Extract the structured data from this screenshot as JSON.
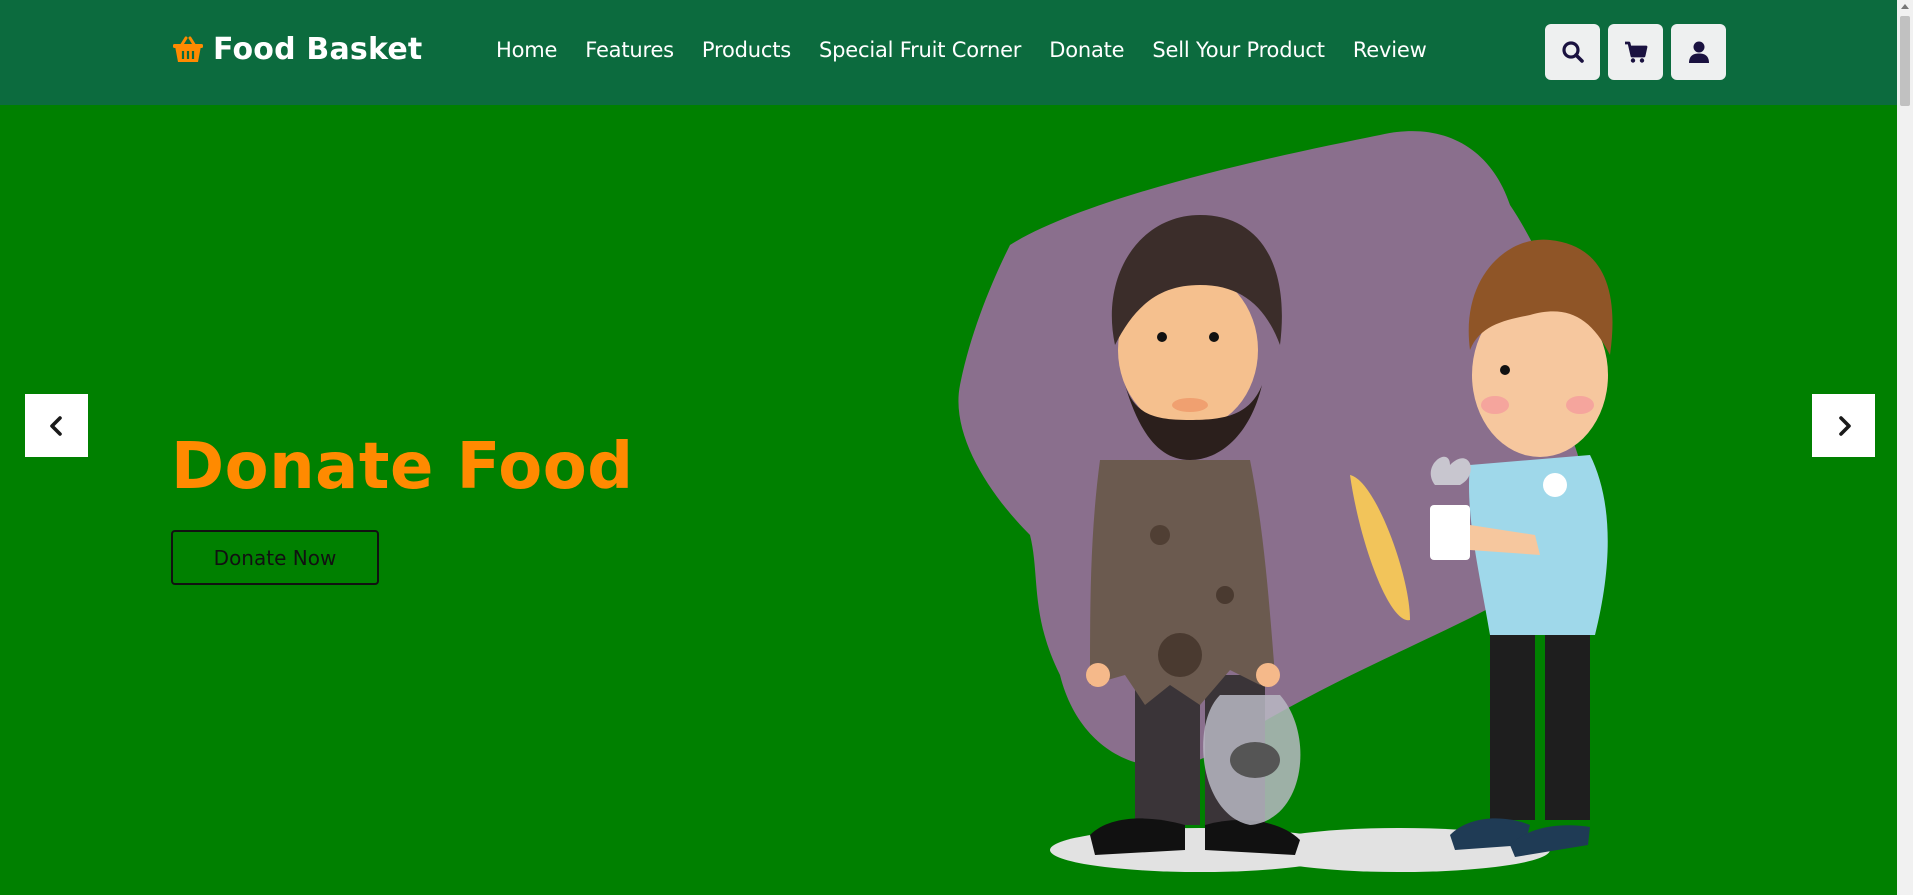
{
  "brand": {
    "name": "Food Basket",
    "icon": "basket-icon"
  },
  "nav": {
    "items": [
      {
        "label": "Home"
      },
      {
        "label": "Features"
      },
      {
        "label": "Products"
      },
      {
        "label": "Special Fruit Corner"
      },
      {
        "label": "Donate"
      },
      {
        "label": "Sell Your Product"
      },
      {
        "label": "Review"
      }
    ]
  },
  "header_icons": [
    "search-icon",
    "cart-icon",
    "user-icon"
  ],
  "hero": {
    "title": "Donate Food",
    "button_label": "Donate Now",
    "prev_icon": "chevron-left-icon",
    "next_icon": "chevron-right-icon"
  },
  "colors": {
    "header_bg": "#0c6b3e",
    "hero_bg": "#008000",
    "accent": "#ff8a00",
    "icon_dark": "#1a1240"
  }
}
